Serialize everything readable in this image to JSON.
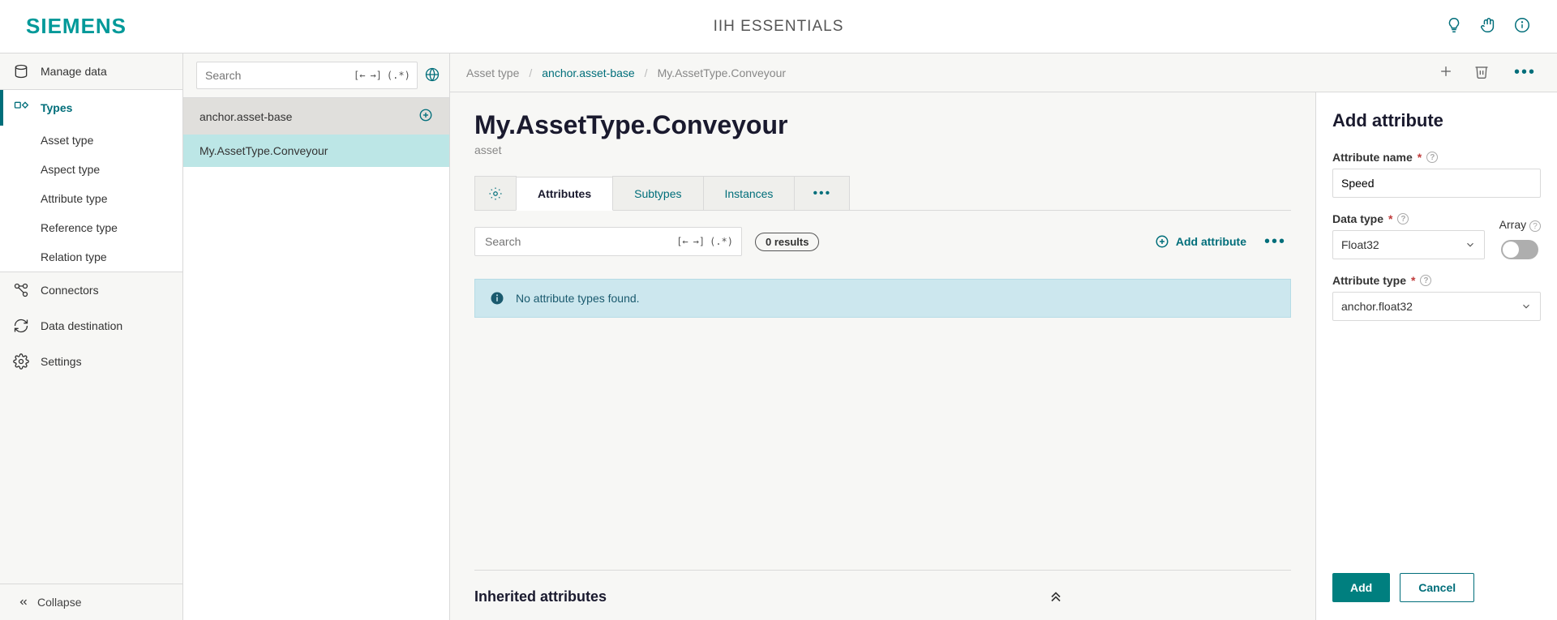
{
  "header": {
    "brand": "SIEMENS",
    "title": "IIH ESSENTIALS"
  },
  "sidebar": {
    "manage_data": "Manage data",
    "types": "Types",
    "sub": {
      "asset_type": "Asset type",
      "aspect_type": "Aspect type",
      "attribute_type": "Attribute type",
      "reference_type": "Reference type",
      "relation_type": "Relation type"
    },
    "connectors": "Connectors",
    "data_destination": "Data destination",
    "settings": "Settings",
    "collapse": "Collapse"
  },
  "tree": {
    "search_placeholder": "Search",
    "base": "anchor.asset-base",
    "item": "My.AssetType.Conveyour"
  },
  "breadcrumb": {
    "root": "Asset type",
    "mid": "anchor.asset-base",
    "leaf": "My.AssetType.Conveyour"
  },
  "page": {
    "title": "My.AssetType.Conveyour",
    "subtitle": "asset"
  },
  "tabs": {
    "attributes": "Attributes",
    "subtypes": "Subtypes",
    "instances": "Instances"
  },
  "attr_area": {
    "search_placeholder": "Search",
    "results_badge": "0 results",
    "add_label": "Add attribute",
    "empty_msg": "No attribute types found.",
    "inherited_label": "Inherited attributes"
  },
  "form": {
    "title": "Add attribute",
    "name_label": "Attribute name",
    "name_value": "Speed",
    "datatype_label": "Data type",
    "datatype_value": "Float32",
    "array_label": "Array",
    "attrtype_label": "Attribute type",
    "attrtype_value": "anchor.float32",
    "add_btn": "Add",
    "cancel_btn": "Cancel"
  }
}
